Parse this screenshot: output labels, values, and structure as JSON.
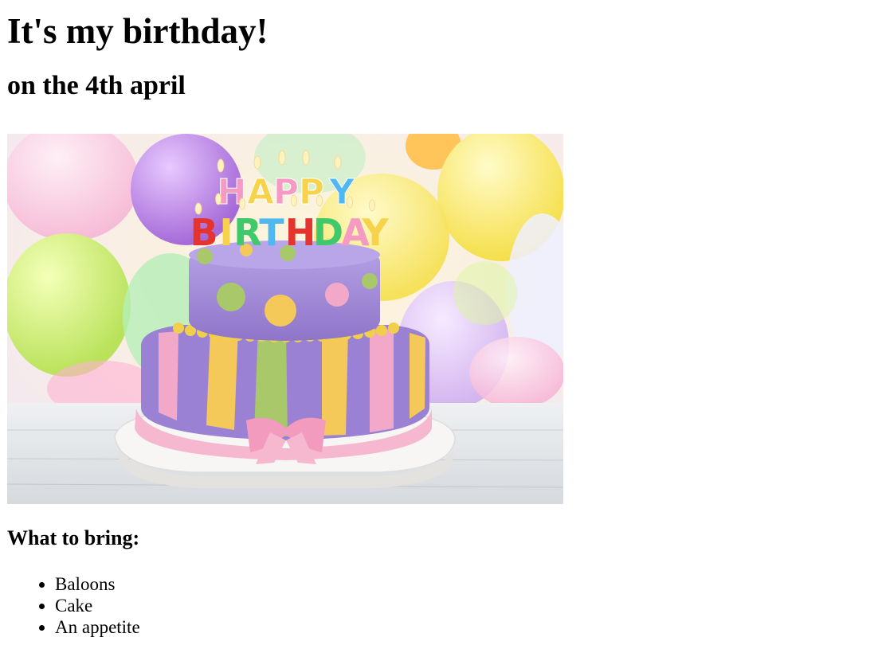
{
  "page": {
    "title": "It's my birthday!",
    "subtitle": "on the 4th april"
  },
  "image": {
    "description": "Two-tier birthday cake with colorful HAPPY BIRTHDAY candles in front of pastel balloons",
    "candles_top": "HAPPY",
    "candles_bottom": "BIRTHDAY"
  },
  "bring": {
    "heading": "What to bring:",
    "items": [
      "Baloons",
      "Cake",
      "An appetite"
    ]
  },
  "colors": {
    "cake_purple": "#a58fd6",
    "cake_yellow": "#f4c95a",
    "cake_green": "#a9c86a",
    "ribbon_pink": "#f6b8cf"
  }
}
